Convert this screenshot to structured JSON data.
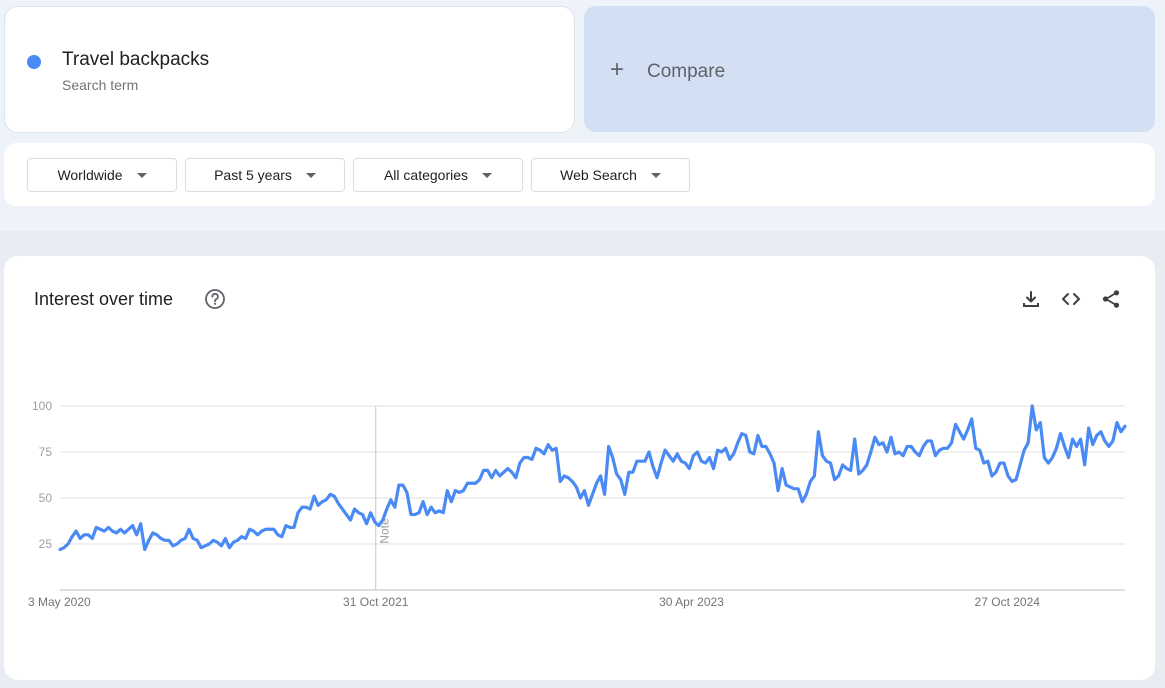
{
  "search_term": {
    "name": "Travel backpacks",
    "subtitle": "Search term",
    "color": "#4a8af4"
  },
  "compare": {
    "label": "Compare",
    "icon": "plus-icon"
  },
  "filters": [
    {
      "label": "Worldwide"
    },
    {
      "label": "Past 5 years"
    },
    {
      "label": "All categories"
    },
    {
      "label": "Web Search"
    }
  ],
  "chart_card": {
    "title": "Interest over time",
    "help_icon": "help-circle-icon",
    "tools": [
      "download-icon",
      "embed-code-icon",
      "share-icon"
    ]
  },
  "chart_data": {
    "type": "line",
    "title": "",
    "xlabel": "",
    "ylabel": "",
    "ylim": [
      0,
      100
    ],
    "yticks": [
      "25",
      "50",
      "75",
      "100"
    ],
    "xtick_labels": [
      "3 May 2020",
      "31 Oct 2021",
      "30 Apr 2023",
      "27 Oct 2024"
    ],
    "x_start": "3 May 2020",
    "x_interval": "week",
    "annotation": {
      "text": "Note",
      "at": "31 Oct 2021"
    },
    "grid": true,
    "series": [
      {
        "color": "#4a8af4",
        "values": [
          22,
          23,
          25,
          29,
          32,
          28,
          30,
          30,
          28,
          34,
          33,
          32,
          34,
          32,
          31,
          33,
          31,
          33,
          35,
          30,
          36,
          22,
          27,
          31,
          30,
          28,
          27,
          27,
          24,
          25,
          27,
          28,
          33,
          28,
          27,
          23,
          24,
          25,
          27,
          26,
          24,
          28,
          23,
          26,
          27,
          29,
          28,
          33,
          32,
          30,
          32,
          33,
          33,
          33,
          30,
          29,
          35,
          34,
          34,
          42,
          45,
          45,
          44,
          51,
          46,
          48,
          49,
          52,
          51,
          47,
          44,
          41,
          38,
          44,
          42,
          41,
          36,
          42,
          37,
          35,
          38,
          44,
          49,
          45,
          57,
          57,
          53,
          41,
          41,
          42,
          48,
          41,
          45,
          42,
          43,
          42,
          54,
          48,
          54,
          53,
          54,
          58,
          58,
          58,
          60,
          65,
          65,
          61,
          65,
          62,
          64,
          66,
          64,
          61,
          69,
          72,
          72,
          71,
          77,
          76,
          74,
          79,
          76,
          77,
          59,
          62,
          61,
          59,
          56,
          50,
          54,
          46,
          52,
          58,
          62,
          52,
          78,
          72,
          63,
          60,
          52,
          64,
          64,
          70,
          70,
          70,
          75,
          67,
          61,
          69,
          76,
          73,
          70,
          74,
          70,
          69,
          66,
          73,
          75,
          70,
          69,
          72,
          66,
          76,
          75,
          77,
          71,
          74,
          80,
          85,
          84,
          75,
          74,
          84,
          78,
          78,
          74,
          69,
          54,
          66,
          57,
          56,
          55,
          55,
          48,
          52,
          59,
          62,
          86,
          73,
          70,
          69,
          60,
          62,
          68,
          66,
          65,
          82,
          63,
          65,
          68,
          75,
          83,
          79,
          80,
          75,
          83,
          74,
          75,
          73,
          78,
          78,
          75,
          73,
          78,
          81,
          81,
          73,
          76,
          77,
          77,
          80,
          90,
          86,
          82,
          87,
          93,
          77,
          76,
          69,
          70,
          62,
          64,
          69,
          69,
          62,
          59,
          60,
          68,
          76,
          80,
          100,
          87,
          91,
          72,
          69,
          72,
          77,
          85,
          78,
          72,
          82,
          78,
          82,
          68,
          88,
          79,
          84,
          86,
          81,
          78,
          81,
          91,
          86,
          89
        ]
      }
    ]
  }
}
